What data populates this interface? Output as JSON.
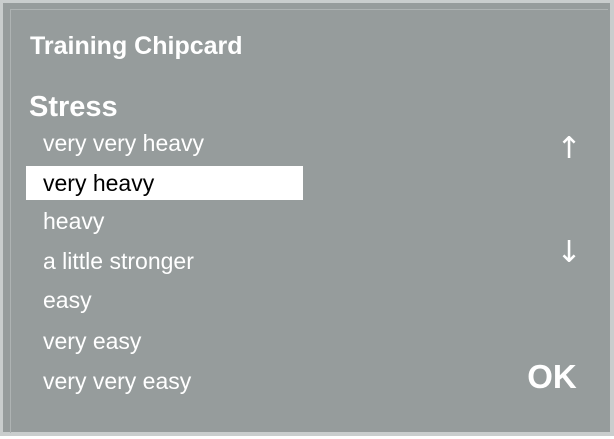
{
  "header": {
    "title": "Training Chipcard"
  },
  "section": {
    "heading": "Stress"
  },
  "stress_list": {
    "selected_index": 1,
    "items": [
      {
        "label": "very very heavy"
      },
      {
        "label": "very heavy"
      },
      {
        "label": "heavy"
      },
      {
        "label": "a little stronger"
      },
      {
        "label": "easy"
      },
      {
        "label": "very easy"
      },
      {
        "label": "very very easy"
      }
    ]
  },
  "controls": {
    "scroll_up_icon": "up-arrow",
    "scroll_up_glyph": "↑",
    "scroll_down_icon": "down-arrow",
    "scroll_down_glyph": "↓",
    "ok_label": "OK"
  },
  "colors": {
    "background": "#969c9c",
    "frame": "#c9cdcd",
    "text": "#ffffff",
    "selection_bg": "#ffffff",
    "selection_text": "#000000"
  }
}
